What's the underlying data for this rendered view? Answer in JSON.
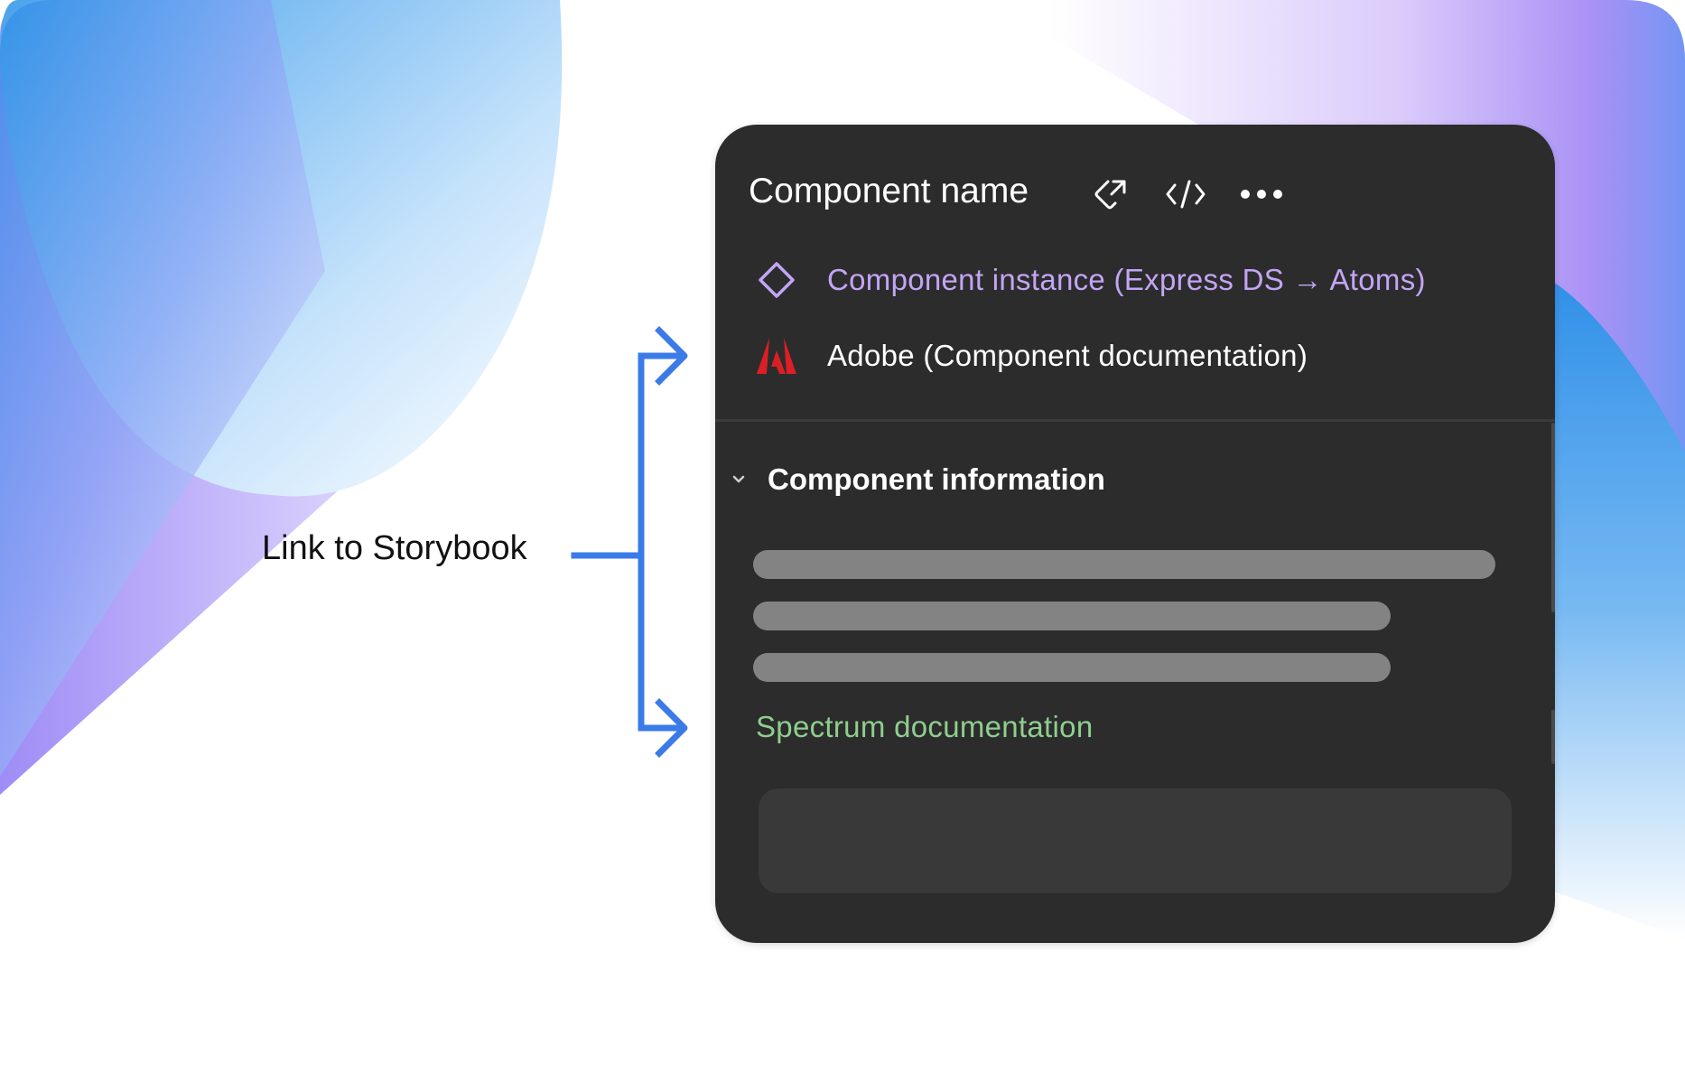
{
  "annotation": {
    "label": "Link to Storybook",
    "accent_color": "#3b7be8"
  },
  "panel": {
    "title": "Component name",
    "header_icons": [
      "link-tag-icon",
      "code-icon",
      "more-icon"
    ],
    "instance_link": {
      "text": "Component instance (Express DS → Atoms)",
      "icon": "diamond-icon",
      "color": "#c3a5f5"
    },
    "adobe_link": {
      "text": "Adobe (Component documentation)",
      "icon": "adobe-logo-icon",
      "color": "#da1f26"
    },
    "section": {
      "title": "Component information",
      "expanded": true,
      "spectrum_link": "Spectrum documentation",
      "spectrum_color": "#8fce8f"
    }
  }
}
